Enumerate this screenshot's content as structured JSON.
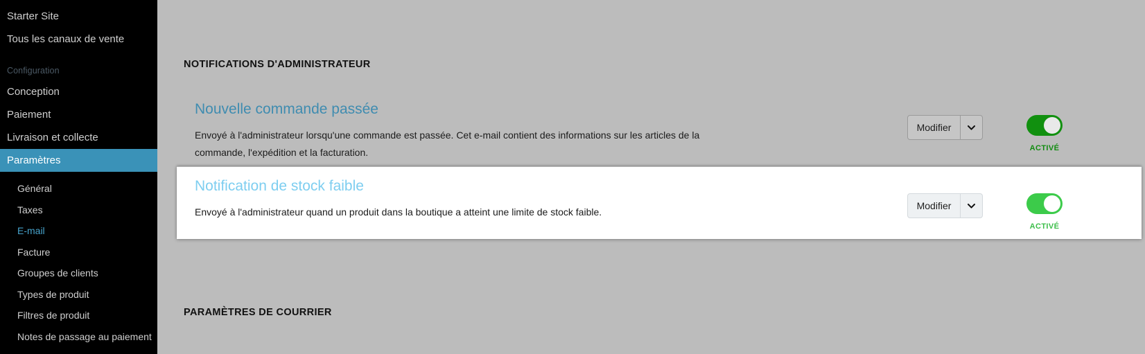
{
  "sidebar": {
    "top_items": [
      {
        "label": "Starter Site"
      },
      {
        "label": "Tous les canaux de vente"
      }
    ],
    "section_label": "Configuration",
    "main_items": [
      {
        "label": "Conception",
        "active": false
      },
      {
        "label": "Paiement",
        "active": false
      },
      {
        "label": "Livraison et collecte",
        "active": false
      },
      {
        "label": "Paramètres",
        "active": true
      }
    ],
    "sub_items": [
      {
        "label": "Général",
        "active": false
      },
      {
        "label": "Taxes",
        "active": false
      },
      {
        "label": "E-mail",
        "active": true
      },
      {
        "label": "Facture",
        "active": false
      },
      {
        "label": "Groupes de clients",
        "active": false
      },
      {
        "label": "Types de produit",
        "active": false
      },
      {
        "label": "Filtres de produit",
        "active": false
      },
      {
        "label": "Notes de passage au paiement",
        "active": false
      }
    ],
    "colors": {
      "background": "#000000",
      "active_background": "#3a92b8",
      "text": "#cfcfcf",
      "section_label": "#4c5a66",
      "sub_active_text": "#47a3cc"
    }
  },
  "main": {
    "headings": {
      "admin_notifications": "NOTIFICATIONS D'ADMINISTRATEUR",
      "mail_settings": "PARAMÈTRES DE COURRIER"
    },
    "cards": [
      {
        "id": "new-order",
        "title": "Nouvelle commande passée",
        "description": "Envoyé à l'administrateur lorsqu'une commande est passée. Cet e-mail contient des informations sur les articles de la commande, l'expédition et la facturation.",
        "edit_button_label": "Modifier",
        "caret_icon": "chevron-down-icon",
        "toggle_state": "on",
        "toggle_label": "ACTIVÉ",
        "toggle_color": "#11900f",
        "highlighted": false
      },
      {
        "id": "low-stock",
        "title": "Notification de stock faible",
        "description": "Envoyé à l'administrateur quand un produit dans la boutique a atteint une limite de stock faible.",
        "edit_button_label": "Modifier",
        "caret_icon": "chevron-down-icon",
        "toggle_state": "on",
        "toggle_label": "ACTIVÉ",
        "toggle_color": "#3ccb4a",
        "highlighted": true
      }
    ],
    "colors": {
      "background": "#bcbcbc",
      "card_highlight_background": "#ffffff",
      "title_normal": "#3f8cb0",
      "title_highlight": "#7ecef0",
      "heading_text": "#111111"
    }
  }
}
